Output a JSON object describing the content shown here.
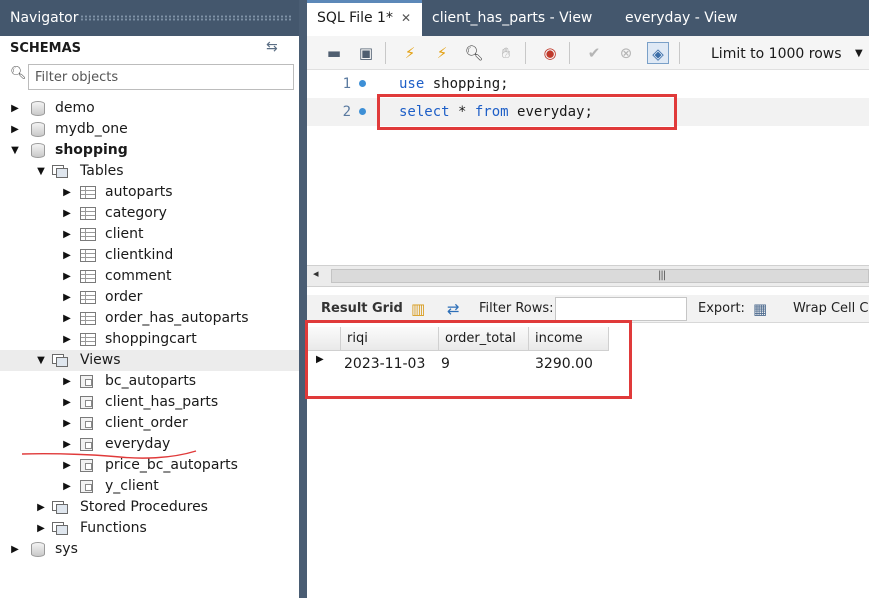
{
  "navigator": {
    "title": "Navigator",
    "schemas_label": "SCHEMAS",
    "filter_placeholder": "Filter objects",
    "tree": {
      "demo": "demo",
      "mydb_one": "mydb_one",
      "shopping": "shopping",
      "tables": "Tables",
      "table_items": [
        "autoparts",
        "category",
        "client",
        "clientkind",
        "comment",
        "order",
        "order_has_autoparts",
        "shoppingcart"
      ],
      "views": "Views",
      "view_items": [
        "bc_autoparts",
        "client_has_parts",
        "client_order",
        "everyday",
        "price_bc_autoparts",
        "y_client"
      ],
      "stored_procedures": "Stored Procedures",
      "functions": "Functions",
      "sys": "sys"
    }
  },
  "tabs": {
    "sql_file": "SQL File 1*",
    "client_has_parts": "client_has_parts - View",
    "everyday": "everyday - View"
  },
  "toolbar": {
    "limit_label": "Limit to 1000 rows"
  },
  "editor": {
    "lines": [
      {
        "number": "1",
        "kw1": "use",
        "rest1": " shopping;"
      },
      {
        "number": "2",
        "kw1": "select",
        "mid": " * ",
        "kw2": "from",
        "rest2": " everyday;"
      }
    ]
  },
  "result_bar": {
    "result_grid": "Result Grid",
    "filter_rows": "Filter Rows:",
    "export": "Export:",
    "wrap_cell": "Wrap Cell Co"
  },
  "grid": {
    "columns": [
      "riqi",
      "order_total",
      "income"
    ],
    "rows": [
      [
        "2023-11-03",
        "9",
        "3290.00"
      ]
    ]
  },
  "colors": {
    "header_bg": "#44576d",
    "annotation_red": "#e03a3a",
    "keyword_blue": "#1e5fc7"
  }
}
